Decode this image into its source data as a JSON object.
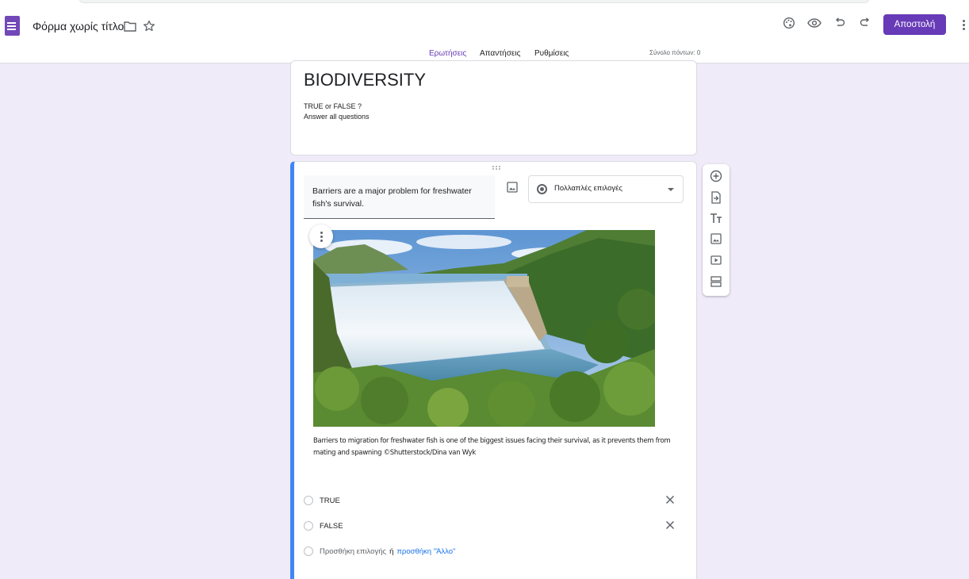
{
  "header": {
    "doc_title": "Φόρμα χωρίς τίτλο",
    "send_label": "Αποστολή",
    "icons": [
      "forms-app-icon",
      "folder-icon",
      "star-icon",
      "palette-icon",
      "eye-icon",
      "undo-icon",
      "redo-icon",
      "more-vert-icon"
    ]
  },
  "tabs": [
    {
      "label": "Ερωτήσεις",
      "active": true
    },
    {
      "label": "Απαντήσεις",
      "active": false
    },
    {
      "label": "Ρυθμίσεις",
      "active": false
    }
  ],
  "points_total": "Σύνολο πόντων: 0",
  "form": {
    "title": "BIODIVERSITY",
    "description_line1": "TRUE or FALSE ?",
    "description_line2": "Answer all questions"
  },
  "question": {
    "text": "Barriers are a major problem for freshwater fish's survival.",
    "type_label": "Πολλαπλές επιλογές",
    "image_caption": "Barriers to migration for freshwater fish is one of the biggest issues facing their survival, as it prevents them from mating and spawning ©Shutterstock/Dina van Wyk",
    "options": [
      "TRUE",
      "FALSE"
    ],
    "add_option": "Προσθήκη επιλογής",
    "or_text": "ή",
    "add_other": "προσθήκη \"Άλλο\""
  },
  "side_toolbar": [
    "add-question-icon",
    "import-questions-icon",
    "add-title-icon",
    "add-image-icon",
    "add-video-icon",
    "add-section-icon"
  ],
  "colors": {
    "accent": "#673ab7",
    "background": "#f0ebf8",
    "active_border": "#4285f4",
    "link": "#1a73e8"
  }
}
